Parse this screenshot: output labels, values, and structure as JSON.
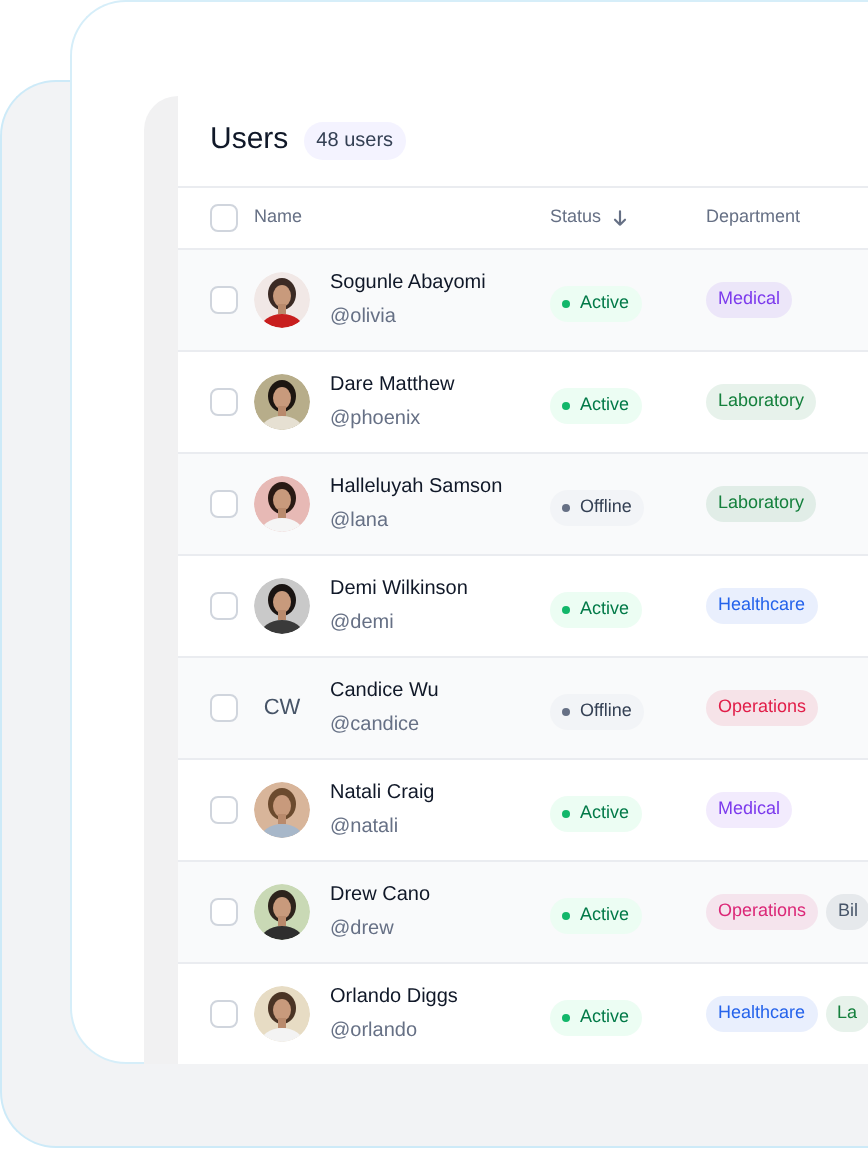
{
  "title": "Users",
  "count_badge": "48 users",
  "select_all": {
    "checked": false
  },
  "columns": [
    {
      "label": "Name",
      "sorted": false
    },
    {
      "label": "Status",
      "sorted": true
    },
    {
      "label": "Department",
      "sorted": false
    }
  ],
  "rows": [
    {
      "checked": false,
      "avatar": {
        "kind": "picture"
      },
      "name": "Sogunle Abayomi",
      "handle": "@olivia",
      "status": {
        "kind": "active",
        "label": "Active"
      },
      "tags": [
        {
          "label": "Medical",
          "color": "#7c3aed"
        }
      ]
    },
    {
      "checked": false,
      "avatar": {
        "kind": "picture"
      },
      "name": "Dare Matthew",
      "handle": "@phoenix",
      "status": {
        "kind": "active",
        "label": "Active"
      },
      "tags": [
        {
          "label": "Laboratory",
          "color": "#15803d"
        }
      ]
    },
    {
      "checked": false,
      "avatar": {
        "kind": "picture"
      },
      "name": "Halleluyah Samson",
      "handle": "@lana",
      "status": {
        "kind": "offline",
        "label": "Offline"
      },
      "tags": [
        {
          "label": "Laboratory",
          "color": "#15803d"
        }
      ]
    },
    {
      "checked": false,
      "avatar": {
        "kind": "picture"
      },
      "name": "Demi Wilkinson",
      "handle": "@demi",
      "status": {
        "kind": "active",
        "label": "Active"
      },
      "tags": [
        {
          "label": "Healthcare",
          "color": "#2563eb"
        }
      ]
    },
    {
      "checked": false,
      "avatar": {
        "kind": "initials",
        "text": "CW"
      },
      "name": "Candice Wu",
      "handle": "@candice",
      "status": {
        "kind": "offline",
        "label": "Offline"
      },
      "tags": [
        {
          "label": "Operations",
          "color": "#e11d48"
        }
      ]
    },
    {
      "checked": false,
      "avatar": {
        "kind": "picture"
      },
      "name": "Natali Craig",
      "handle": "@natali",
      "status": {
        "kind": "active",
        "label": "Active"
      },
      "tags": [
        {
          "label": "Medical",
          "color": "#7c3aed"
        }
      ]
    },
    {
      "checked": false,
      "avatar": {
        "kind": "picture"
      },
      "name": "Drew Cano",
      "handle": "@drew",
      "status": {
        "kind": "active",
        "label": "Active"
      },
      "tags": [
        {
          "label": "Operations",
          "color": "#db2777"
        },
        {
          "label": "Bil",
          "color": "#475569"
        }
      ]
    },
    {
      "checked": false,
      "avatar": {
        "kind": "picture"
      },
      "name": "Orlando Diggs",
      "handle": "@orlando",
      "status": {
        "kind": "active",
        "label": "Active"
      },
      "tags": [
        {
          "label": "Healthcare",
          "color": "#2563eb"
        },
        {
          "label": "La",
          "color": "#15803d"
        }
      ]
    }
  ]
}
